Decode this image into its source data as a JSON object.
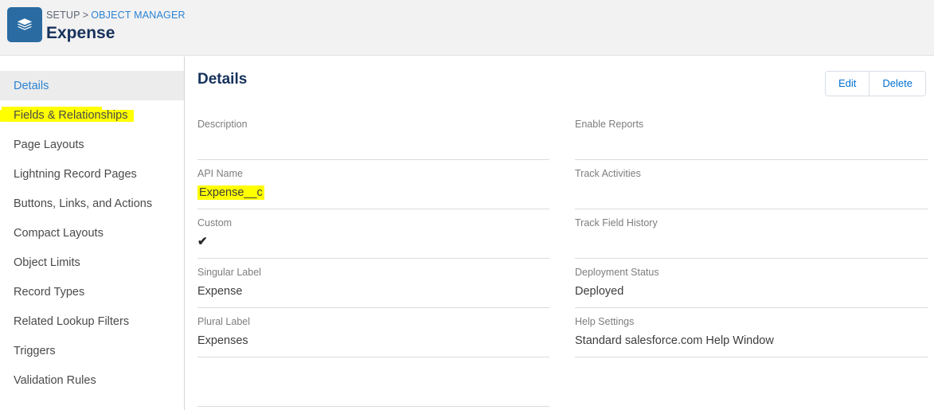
{
  "header": {
    "icon": "layers-stack-icon",
    "icon_color": "#2a6ca2",
    "breadcrumb_setup": "SETUP",
    "breadcrumb_separator": ">",
    "breadcrumb_object_manager": "OBJECT MANAGER",
    "title": "Expense"
  },
  "sidebar": {
    "items": [
      {
        "label": "Details",
        "selected": true,
        "highlighted": false
      },
      {
        "label": "Fields & Relationships",
        "selected": false,
        "highlighted": true
      },
      {
        "label": "Page Layouts",
        "selected": false,
        "highlighted": false
      },
      {
        "label": "Lightning Record Pages",
        "selected": false,
        "highlighted": false
      },
      {
        "label": "Buttons, Links, and Actions",
        "selected": false,
        "highlighted": false
      },
      {
        "label": "Compact Layouts",
        "selected": false,
        "highlighted": false
      },
      {
        "label": "Object Limits",
        "selected": false,
        "highlighted": false
      },
      {
        "label": "Record Types",
        "selected": false,
        "highlighted": false
      },
      {
        "label": "Related Lookup Filters",
        "selected": false,
        "highlighted": false
      },
      {
        "label": "Triggers",
        "selected": false,
        "highlighted": false
      },
      {
        "label": "Validation Rules",
        "selected": false,
        "highlighted": false
      }
    ]
  },
  "main": {
    "heading": "Details",
    "buttons": {
      "edit": "Edit",
      "delete": "Delete"
    },
    "left_fields": [
      {
        "label": "Description",
        "value": "",
        "highlighted": false,
        "check": false
      },
      {
        "label": "API Name",
        "value": "Expense__c",
        "highlighted": true,
        "check": false
      },
      {
        "label": "Custom",
        "value": "✔",
        "highlighted": false,
        "check": true
      },
      {
        "label": "Singular Label",
        "value": "Expense",
        "highlighted": false,
        "check": false
      },
      {
        "label": "Plural Label",
        "value": "Expenses",
        "highlighted": false,
        "check": false
      },
      {
        "label": "",
        "value": "",
        "highlighted": false,
        "check": false
      }
    ],
    "right_fields": [
      {
        "label": "Enable Reports",
        "value": "",
        "highlighted": false,
        "check": false
      },
      {
        "label": "Track Activities",
        "value": "",
        "highlighted": false,
        "check": false
      },
      {
        "label": "Track Field History",
        "value": "",
        "highlighted": false,
        "check": false
      },
      {
        "label": "Deployment Status",
        "value": "Deployed",
        "highlighted": false,
        "check": false
      },
      {
        "label": "Help Settings",
        "value": "Standard salesforce.com Help Window",
        "highlighted": false,
        "check": false
      }
    ]
  },
  "colors": {
    "brand_blue": "#2a83d4",
    "link_blue": "#0070d2",
    "title_navy": "#16325c",
    "header_bg": "#f3f2f2",
    "selected_bg": "#ececec",
    "highlight_yellow": "#ffff00"
  }
}
